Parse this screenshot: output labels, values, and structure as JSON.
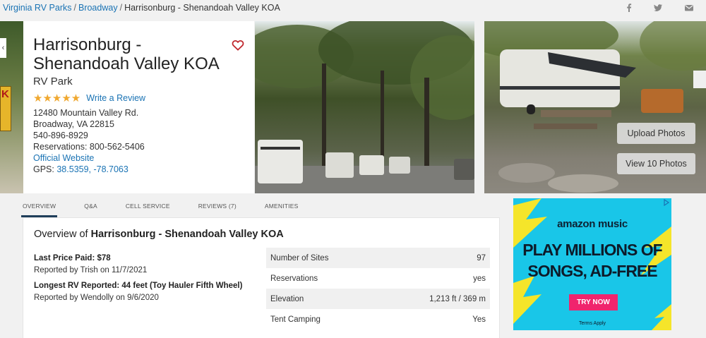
{
  "breadcrumb": {
    "items": [
      "Virginia RV Parks",
      "Broadway"
    ],
    "current": "Harrisonburg - Shenandoah Valley KOA",
    "separator": "/"
  },
  "share_icons": [
    "facebook-icon",
    "twitter-icon",
    "email-icon"
  ],
  "park": {
    "name": "Harrisonburg - Shenandoah Valley KOA",
    "type": "RV Park",
    "stars": "★★★★★",
    "write_review": "Write a Review",
    "address_line1": "12480 Mountain Valley Rd.",
    "address_line2": "Broadway, VA 22815",
    "phone": "540-896-8929",
    "reservations": "Reservations: 800-562-5406",
    "website": "Official Website",
    "gps_label": "GPS:",
    "gps_value": "38.5359, -78.7063"
  },
  "photos": {
    "upload_label": "Upload Photos",
    "view_label": "View 10 Photos",
    "left_sign_text": "K"
  },
  "tabs": [
    {
      "label": "OVERVIEW",
      "active": true
    },
    {
      "label": "Q&A",
      "active": false
    },
    {
      "label": "CELL SERVICE",
      "active": false
    },
    {
      "label": "REVIEWS (7)",
      "active": false
    },
    {
      "label": "AMENITIES",
      "active": false
    }
  ],
  "overview": {
    "title_prefix": "Overview of",
    "title_name": "Harrisonburg - Shenandoah Valley KOA",
    "last_price_label": "Last Price Paid: $78",
    "last_price_reported": "Reported by Trish on 11/7/2021",
    "longest_rv_label": "Longest RV Reported: 44 feet (Toy Hauler Fifth Wheel)",
    "longest_rv_reported": "Reported by Wendolly on 9/6/2020",
    "facts": [
      {
        "label": "Number of Sites",
        "value": "97"
      },
      {
        "label": "Reservations",
        "value": "yes"
      },
      {
        "label": "Elevation",
        "value": "1,213 ft / 369 m"
      },
      {
        "label": "Tent Camping",
        "value": "Yes"
      }
    ]
  },
  "ad": {
    "brand": "amazon music",
    "headline_line1": "PLAY MILLIONS OF",
    "headline_line2": "SONGS, AD-FREE",
    "cta": "TRY NOW",
    "terms": "Terms Apply"
  },
  "colors": {
    "link": "#1a73b4",
    "star": "#f0a830",
    "heart": "#c0272d",
    "tab_underline": "#1f3e5a",
    "ad_background": "#19c6e8",
    "ad_cta": "#f0246d"
  }
}
